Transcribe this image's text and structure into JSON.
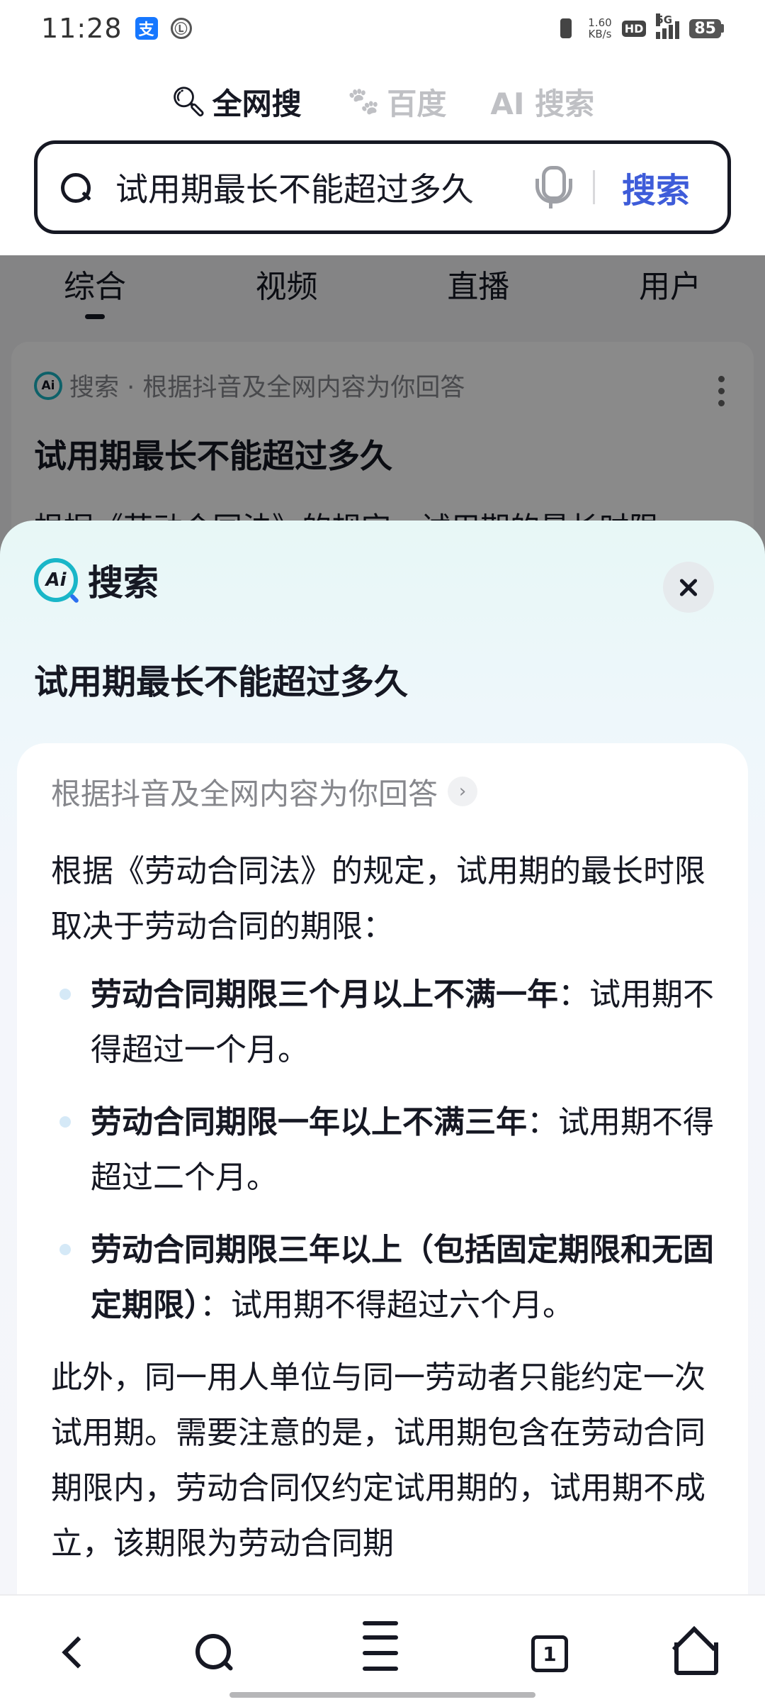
{
  "status_bar": {
    "time": "11:28",
    "app_icon_1": "支",
    "app_icon_2": "Ⓛ",
    "net_speed_value": "1.60",
    "net_speed_unit": "KB/s",
    "hd": "HD",
    "network": "5G",
    "battery": "85"
  },
  "source_tabs": [
    {
      "icon": "search-icon",
      "label": "全网搜",
      "active": true
    },
    {
      "icon": "paw-icon",
      "label": "百度",
      "active": false
    },
    {
      "icon": "ai-icon",
      "label": "AI 搜索",
      "active": false
    }
  ],
  "search": {
    "query": "试用期最长不能超过多久",
    "submit_label": "搜索"
  },
  "result_tabs": [
    "综合",
    "视频",
    "直播",
    "用户"
  ],
  "result_card": {
    "source": "搜索 · 根据抖音及全网内容为你回答",
    "title": "试用期最长不能超过多久",
    "snippet": "根据《劳动合同法》的规定，试用期的最长时限"
  },
  "sheet": {
    "logo_text": "搜索",
    "logo_mark": "Ai",
    "query": "试用期最长不能超过多久",
    "answer": {
      "source_note": "根据抖音及全网内容为你回答",
      "intro": "根据《劳动合同法》的规定，试用期的最长时限取决于劳动合同的期限：",
      "bullets": [
        {
          "bold": "劳动合同期限三个月以上不满一年",
          "rest": "：试用期不得超过一个月。"
        },
        {
          "bold": "劳动合同期限一年以上不满三年",
          "rest": "：试用期不得超过二个月。"
        },
        {
          "bold": "劳动合同期限三年以上（包括固定期限和无固定期限）",
          "rest": "：试用期不得超过六个月。"
        }
      ],
      "extra": "此外，同一用人单位与同一劳动者只能约定一次试用期。需要注意的是，试用期包含在劳动合同期限内，劳动合同仅约定试用期的，试用期不成立，该期限为劳动合同期"
    }
  },
  "bottom_nav": {
    "tab_count": "1",
    "menu_badge_color": "#fe2c55"
  }
}
